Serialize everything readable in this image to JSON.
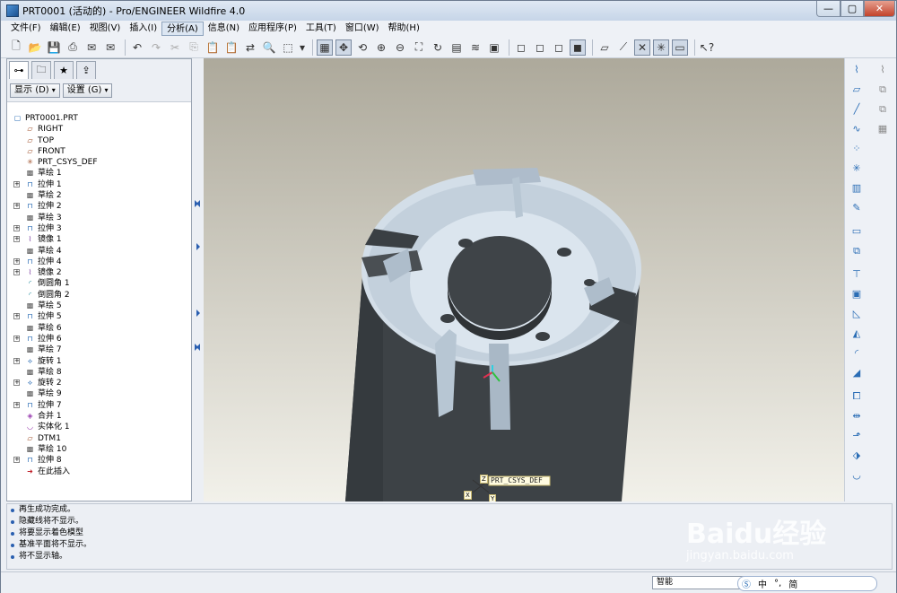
{
  "window": {
    "title": "PRT0001 (活动的) - Pro/ENGINEER Wildfire 4.0"
  },
  "menu": [
    {
      "label": "文件(F)"
    },
    {
      "label": "编辑(E)"
    },
    {
      "label": "视图(V)"
    },
    {
      "label": "插入(I)"
    },
    {
      "label": "分析(A)"
    },
    {
      "label": "信息(N)"
    },
    {
      "label": "应用程序(P)"
    },
    {
      "label": "工具(T)"
    },
    {
      "label": "窗口(W)"
    },
    {
      "label": "帮助(H)"
    }
  ],
  "model_tree": {
    "show_label": "显示",
    "show_key": "(D)",
    "settings_label": "设置",
    "settings_key": "(G)",
    "root": "PRT0001.PRT",
    "items": [
      {
        "label": "RIGHT",
        "icon": "datum-plane-icon",
        "expand": false
      },
      {
        "label": "TOP",
        "icon": "datum-plane-icon",
        "expand": false
      },
      {
        "label": "FRONT",
        "icon": "datum-plane-icon",
        "expand": false
      },
      {
        "label": "PRT_CSYS_DEF",
        "icon": "csys-icon",
        "expand": false
      },
      {
        "label": "草绘 1",
        "icon": "sketch-icon",
        "expand": false
      },
      {
        "label": "拉伸 1",
        "icon": "extrude-icon",
        "expand": true
      },
      {
        "label": "草绘 2",
        "icon": "sketch-icon",
        "expand": false
      },
      {
        "label": "拉伸 2",
        "icon": "extrude-icon",
        "expand": true
      },
      {
        "label": "草绘 3",
        "icon": "sketch-icon",
        "expand": false
      },
      {
        "label": "拉伸 3",
        "icon": "extrude-icon",
        "expand": true
      },
      {
        "label": "镜像 1",
        "icon": "mirror-icon",
        "expand": true
      },
      {
        "label": "草绘 4",
        "icon": "sketch-icon",
        "expand": false
      },
      {
        "label": "拉伸 4",
        "icon": "extrude-icon",
        "expand": true
      },
      {
        "label": "镜像 2",
        "icon": "mirror-icon",
        "expand": true
      },
      {
        "label": "倒圆角 1",
        "icon": "round-icon",
        "expand": false
      },
      {
        "label": "倒圆角 2",
        "icon": "round-icon",
        "expand": false
      },
      {
        "label": "草绘 5",
        "icon": "sketch-icon",
        "expand": false
      },
      {
        "label": "拉伸 5",
        "icon": "extrude-icon",
        "expand": true
      },
      {
        "label": "草绘 6",
        "icon": "sketch-icon",
        "expand": false
      },
      {
        "label": "拉伸 6",
        "icon": "extrude-icon",
        "expand": true
      },
      {
        "label": "草绘 7",
        "icon": "sketch-icon",
        "expand": false
      },
      {
        "label": "旋转 1",
        "icon": "revolve-icon",
        "expand": true
      },
      {
        "label": "草绘 8",
        "icon": "sketch-icon",
        "expand": false
      },
      {
        "label": "旋转 2",
        "icon": "revolve-icon",
        "expand": true
      },
      {
        "label": "草绘 9",
        "icon": "sketch-icon",
        "expand": false
      },
      {
        "label": "拉伸 7",
        "icon": "extrude-icon",
        "expand": true
      },
      {
        "label": "合并 1",
        "icon": "merge-icon",
        "expand": false
      },
      {
        "label": "实体化 1",
        "icon": "solidify-icon",
        "expand": false
      },
      {
        "label": "DTM1",
        "icon": "datum-plane-icon",
        "expand": false
      },
      {
        "label": "草绘 10",
        "icon": "sketch-icon",
        "expand": false
      },
      {
        "label": "拉伸 8",
        "icon": "extrude-icon",
        "expand": true
      },
      {
        "label": "在此插入",
        "icon": "insert-here-icon",
        "expand": false
      }
    ]
  },
  "viewport": {
    "csys_label": "PRT_CSYS_DEF",
    "axis_z": "Z",
    "axis_x": "X",
    "axis_y": "Y"
  },
  "messages": [
    "再生成功完成。",
    "隐藏线将不显示。",
    "将要显示着色模型",
    "基准平面将不显示。",
    "将不显示轴。"
  ],
  "status": {
    "filter": "智能"
  },
  "ime": {
    "items": [
      "中",
      "°,",
      "简"
    ]
  },
  "watermark": {
    "brand": "Baidu经验",
    "url": "jingyan.baidu.com"
  },
  "colors": {
    "accent": "#2a6db5",
    "model_face": "#c9d6e1",
    "model_dark": "#3f4448"
  }
}
